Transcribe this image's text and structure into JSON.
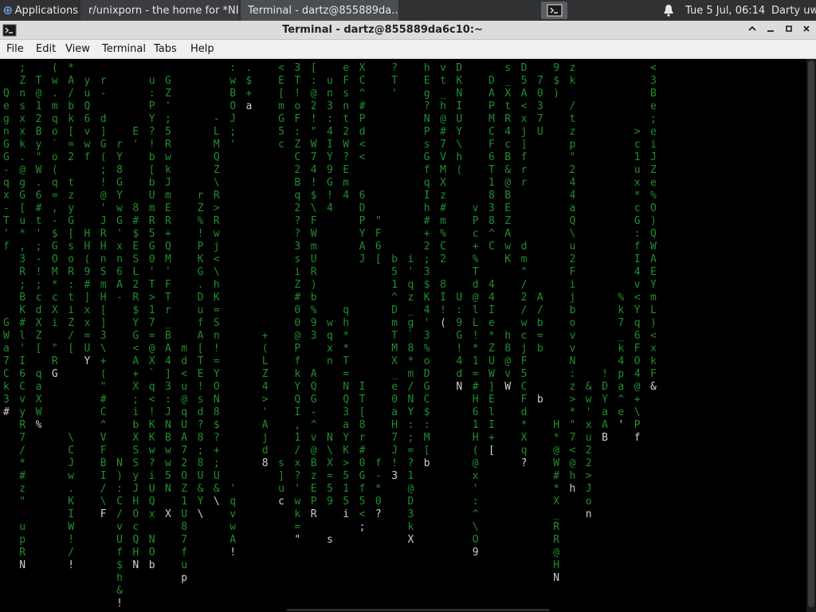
{
  "taskbar": {
    "apps_label": "Applications",
    "browser_label": "r/unixporn - the home for *NI...",
    "terminal_label": "Terminal - dartz@855889da...",
    "clock": "Tue  5 Jul, 06:14",
    "user": "Darty uwu"
  },
  "window": {
    "title": "Terminal - dartz@855889da6c10:~"
  },
  "menu": {
    "file": "File",
    "edit": "Edit",
    "view": "View",
    "terminal": "Terminal",
    "tabs": "Tabs",
    "help": "Help"
  },
  "colors": {
    "rain": "#1f8f2a",
    "rain_head": "#cfcfcf",
    "background": "#000000"
  },
  "matrix_columns": [
    "\n\nQ\ne\ng\nn\nG\nG\n-\nq\nx\n-\nT\n'\nf\n\n\n\n\n\nG\nW\na\n7\nC\nk\n3\n#",
    ";\nZ\nn\ns\nx\nx\nk\n.\n@\ng\nG\n[\nu\n*\n,\n3\nR\n;\nB\nK\n#\nl\n'\nI\n6\nC\nv\ny\nR\n7\n/\n*\n#\nz\n\"\n \nu\np\nR\nN",
    "\nT\n@\n1\n2\nB\ny\n\"\nW\n.\n6\n#\nt\n'\n;\n-\n!\n;\nc\nd\nX\nZ\n[\n\nq\na\nX\nW\n%",
    "(\nw\n.\nm\nq\no\n`\no\n(\nq\n=\n,\n-\n$\nG\nO\nM\n*\nc\nX\ni\n\n\"\nR\nG",
    "*\nA\n/\nb\nk\n[\n=\n2\n\nt\nz\ny\nG\n[\ns\no\nR\n:\nt\ni\nZ\n/\n[\n\n\n\n\n\n\n\\\nC\nJ\nw\n.\nK\nI\nW\n!\n/\n!",
    "\ny\nu\nQ\n6\nv\nw\nf\n\n\n\n\n\nH\nH\n(\n9\n#\n]\nx\nx\n=\nU\nY",
    "\nr\n-\n\nd\n]\nG\n(\n;\n!\n@\n'\nJ\nR\nH\nn\nS\nm\nH\n[\n]\n3\n\\\n+\n(\n\"\n#\nC\n^\nV\nF\nB\nI\n/\n\\\nF",
    "\n\n\n\n\n\nr\nY\n8\nG\nY\nw\nG\n'\nx\nn\n6\nA\n-\n\n\n\n\n\n\n\n\n\n\n\n\nN\n)\n:\nC\n/\nv\nU\nf\n$\nh\n&\n!",
    "\n\n\n\n\nE\n'\n\n\n\n\n8\n#\n$\nE\nS\nL\n2\nR\n$\nY\nG\n<\nA\n+\nX\n;\ni\nb\nX\nS\nS\ny\nJ\nH\nO\nc\nQ\nH\nN",
    "\nu\n:\nP\nY\n?\n!\nb\n[\nb\nU\nm\nR\n5\nG\n0\n'\nT\n>\n1\n7\n=\n@\nX\n`\nq\n<\n!\nK\nK\nw\n?\ni\nU\nQ\nx\n\nN\nO\nb",
    "\nG\nZ\n'\n;\n5\nR\nw\nk\nJ\nm\nE\nR\n+\nQ\nM\n'\nF\nT\nr\n_\nB\nA\n4\n]\n3\n:\nJ\nN\nB\nw\nw\n5\nN\n \nX",
    "\n\n\n\n\n\n\n\n\n\n\n\n\n\n\n\n\n\n\n\n\n\nm\nd\n<\nu\n@\nq\nU\nA\n7\n2\nO\nZ\n1\nU\n8\n7\nf\nu\np",
    "\n\n\n\n\n\n\n\n\n\nr\nZ\n%\n!\nP\nK\nG\n.\nD\nu\nf\nA\n[\nT\nE\n!\ns\nd\n?\n8\n;\n8\nU\n&\nY\n\\",
    "\n\n\n\n-\nL\nM\nQ\nZ\n\\\nR\n>\nR\nw\nj\n<\n\\\nh\nK\n=\nS\nn\n!\n=\nY\nO\nN\n8\n$\n?\n+\n;\nU\n&\n\\",
    ":\nw\nB\nO\nJ\n;\n'\n\n\n\n\n\n\n\n\n\n\n\n\n\n\n\n\n\n\n\n\n\n\n\n\n\n\n'\nq\nv\nw\nA\n!",
    ".\n$\n+\na\n\n\n\n\n\n\n\n\n\n\n\n\n\n\n\n\n\n\n\n\n\n\n\n\n\n\n\n\n\n\n\n\n\n\n\n\n",
    "\n\n\n\n\n\n\n\n\n\n\n\n\n\n\n\n\n\n\n\n\n+\n(\nL\nZ\n4\n>\n'\nA\nj\nd\n8\n\n\n\n\n\n\n\n\n",
    "<\nE\n[\nm\nG\n5\nc\n\n\n\n\n\n\n\n\n\n\n\n\n\n\n\n\n\n\n\n\n\n\n\n\ns\n]\nu\nc",
    "3\nT\n!\no\nF\n:\nZ\nC\n2\nB\nq\n2\n?\n?\n3\ns\ni\nZ\n#\n0\n0\n@\nP\nf\nk\nY\nQ\nI\n,\n1\n/\nx\n?\n'\nw\nk\n=\n\"",
    "[\n:\n@\n2\n!\n\"\nW\n7\n4\n!\n$\n\\\nF\nW\nm\nU\nR\n)\nb\n%\n9\n3\n\n\nA\nQ\nG\n-\n^\nv\n@\nB\nz\nE\nP\nR",
    "\nu\nn\n3\n:\n4\nI\nY\n9\nG\n!\n4\n\n\n\n\n\n\n\n\nw\nq\nx\nn\n\n\n\n\n\nN\n\\\nX\n=\n5\n9\n \n \ns",
    "e\nF\ns\nn\nt\n2\nW\n?\nE\nm\n4\n\n\n\n\n\n\n\n\nq\nh\n*\n*\nT\n=\nN\nQ\n3\na\nY\nK\n>\n5\n1\n5\ni",
    "X\nC\n^\n#\nP\nd\n<\n<\n\n\n6\nD\nP\nY\nA\nJ\n\n\n\n\n\n\n\n\n\nI\nT\n[\n8\nr\n#\n0\nG\nf\n5\n<\n;",
    "\n\n\n\n\n\n\n\n\n\n\n\n\"\nF\n6\n[\n\n\n\n\n\n\n\n\n\n\n\n\n\n\n\nf\n-\n*\n0\n?",
    "?\nT\n'\n\n\n\n\n\n\n\n\n\n\n\n\nb\n5\n1\n^\nD\nm\nT\nM\nX\n_\ne\n0\na\nH\n7\nJ\n!\n3",
    "\n\n\n\n\n\n\n\n\n\n\n\n\n\n\ni\n'\nq\nz\n_\ng\n`\n8\n*\nm\n/\nN\nY\n:\n;\n=\n?\n1\n@\nD\n3\nk\nX",
    "h\nE\ng\n?\nN\nP\ns\nG\nf\nq\nI\nh\n#\n+\n2\n;\n3\n$\nK\n4\n'\n3\n%\no\nD\nG\nC\n$\n:\nM\n[\nb",
    "v\nt\n_\nh\n@\n#\n7\nV\nM\nX\nz\n#\nm\n%\nC\n2\n\n8\nI\n!\n(\n\n\n\n\n\n\n\n\n\n\n\n\n",
    "D\nK\nN\nI\nU\nY\n\\\nh\n(\n\n\n\n\n\n\n\n\n\nU\n:\n9\nG\n!\n4\nd\nN",
    "\n\n\n\n\n\n\n\n\n\n\nv\nP\nc\n+\n%\nT\nd\n@\nl\nL\n!\n*\n1\n=\n#\nH\n6\n1\nH\n(\n@\nx\n'\n:\n^\n\\\nO\n9",
    "\nD\nA\nP\nM\nC\nF\n6\nT\n1\n8\n3\n8\n^\nC\n\n\n4\n4\nI\ne\n*\nZ\nU\nW\n]\nE\nl\nI\n+\n[",
    "s\n_\nX\nt\nR\n4\nc\nB\n&\n@\nB\nE\nZ\nA\nw\nK\n\n\n\n\n\nh\n8\n@\nv\nW",
    "D\n5\nA\n<\nx\nj\n]\nf\nr\nr\n\n\n\n\nd\nm\n\"\n/\n2\n/\nw\nc\nj\nF\n5\nC\nF\nd\n*\nX\nq\n?",
    "\n7\n0\n3\n7\nU\n\n\n\n\n\n\n\n\n\n\n\n\nA\n/\nb\n=\nb\n\n\n\nb",
    "9\n$\n)\n\n\n\n\n\n\n\n\n\n\n\n\n\n\n\n\n\n\n\n\n\n\n\n\n\nH\n*\n@\nW\n#\n*\nX\n_\nR\nR\n@\nH\nN",
    "z\nk\n\n/\nt\nz\np\n\"\n2\n4\n4\na\nQ\n\\\nu\n2\nF\ni\nj\nb\no\nv\nv\nN\n:\nz\n>\n*\n\"\n7\n<\n@\nh\nh",
    "\n\n\n\n\n\n\n\n\n\n\n\n\n\n\n\n\n\n\n\n\n\n\n\n\n&\nw\n'\nx\nu\n2\n2\n>\nJ\no\nn",
    "\n\n\n\n\n\n\n\n\n\n\n\n\n\n\n\n\n\n\n\n\n\n\n\n!\nD\nY\na\nA\nB",
    "\n\n\n\n\n\n\n\n\n\n\n\n\n\n\n\n\n\n%\nk\n7\n_\nk\n4\np\na\n^\ne\n'",
    "\n\n\n\n\n>\nc\n1\nu\nx\n*\nc\nG\n:\nf\nI\n4\nv\n<\nY\nq\n6\nF\nO\n4\n@\n+\n\\\nP\nf",
    "<\n3\nB\ne\n;\ne\ni\nJ\nZ\ne\n%\nO\n)\nQ\nW\nA\nE\nY\nm\nL\n)\n<\nx\nk\nF\n&"
  ]
}
